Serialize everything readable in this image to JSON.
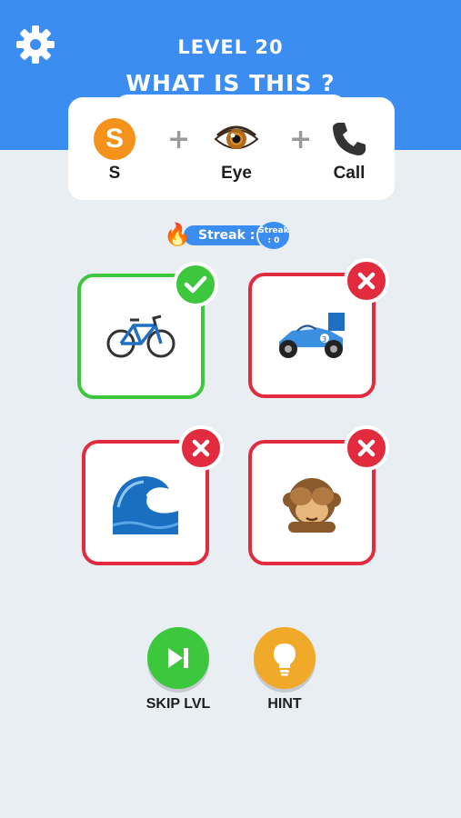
{
  "header": {
    "level_label": "LEVEL 20",
    "question": "WHAT IS THIS ?",
    "bg_color": "#3b8df2"
  },
  "settings": {
    "icon": "gear-icon"
  },
  "clues": [
    {
      "label": "S",
      "icon": "letter-s-icon",
      "glyph": "S"
    },
    {
      "label": "Eye",
      "icon": "eye-icon"
    },
    {
      "label": "Call",
      "icon": "telephone-icon"
    }
  ],
  "plus_sign": "+",
  "streak": {
    "label": "Streak :",
    "badge_title": "Streak",
    "badge_value": ": 0",
    "icon": "fire-icon"
  },
  "options": [
    {
      "name": "bicycle",
      "emoji": "🚲",
      "state": "correct",
      "badge_icon": "check-icon"
    },
    {
      "name": "racing-car",
      "emoji": "🏎️",
      "state": "wrong",
      "badge_icon": "x-icon"
    },
    {
      "name": "water-wave",
      "emoji": "🌊",
      "state": "wrong",
      "badge_icon": "x-icon"
    },
    {
      "name": "see-no-evil-monkey",
      "emoji": "🙈",
      "state": "wrong",
      "badge_icon": "x-icon"
    }
  ],
  "controls": {
    "skip": {
      "label": "SKIP LVL",
      "icon": "skip-next-icon",
      "color": "#3dc73d"
    },
    "hint": {
      "label": "HINT",
      "icon": "lightbulb-icon",
      "color": "#f0a928"
    }
  },
  "colors": {
    "correct": "#3dc73d",
    "wrong": "#e22b3e",
    "background": "#e9eef3"
  }
}
